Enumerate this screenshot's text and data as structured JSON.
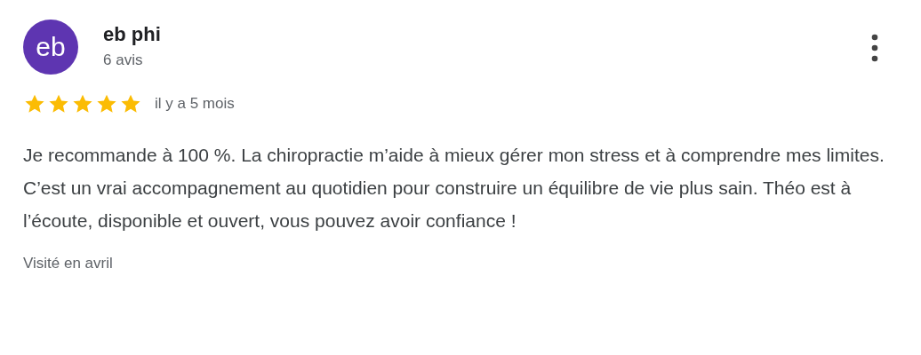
{
  "reviewer": {
    "initials": "eb",
    "name": "eb phi",
    "review_count": "6 avis"
  },
  "review": {
    "stars": 5,
    "time": "il y a 5 mois",
    "text": "Je recommande à 100 %. La chiropractie m’aide à mieux gérer mon stress et à comprendre mes limites. C’est un vrai accompagnement au quotidien pour construire un équilibre de vie plus sain. Théo est à l’écoute, disponible et ouvert, vous pouvez avoir confiance !",
    "visit": "Visité en avril"
  }
}
